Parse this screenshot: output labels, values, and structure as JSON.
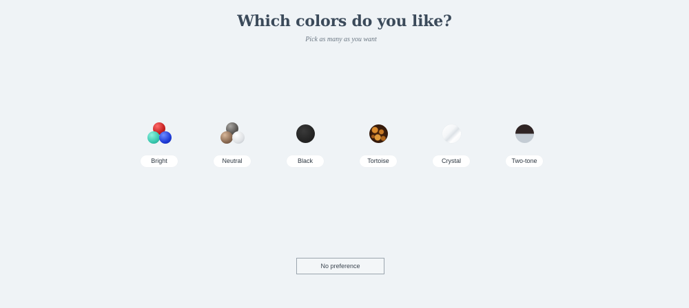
{
  "header": {
    "title": "Which colors do you like?",
    "subtitle": "Pick as many as you want"
  },
  "options": [
    {
      "label": "Bright",
      "swatch": "bright-swatch",
      "colors": [
        "#d42a2a",
        "#3ecbb3",
        "#1f3fd6"
      ]
    },
    {
      "label": "Neutral",
      "swatch": "neutral-swatch",
      "colors": [
        "#5a5754",
        "#8a6a52",
        "#dfe2e5"
      ]
    },
    {
      "label": "Black",
      "swatch": "black-swatch",
      "colors": [
        "#242424"
      ]
    },
    {
      "label": "Tortoise",
      "swatch": "tortoise-swatch",
      "colors": [
        "#6b3a14",
        "#c77a26",
        "#2a150a"
      ]
    },
    {
      "label": "Crystal",
      "swatch": "crystal-swatch",
      "colors": [
        "#ffffff",
        "#e6eaee"
      ]
    },
    {
      "label": "Two-tone",
      "swatch": "two-tone-swatch",
      "colors": [
        "#2f2424",
        "#c4ccd4"
      ]
    }
  ],
  "no_preference": {
    "label": "No preference"
  }
}
